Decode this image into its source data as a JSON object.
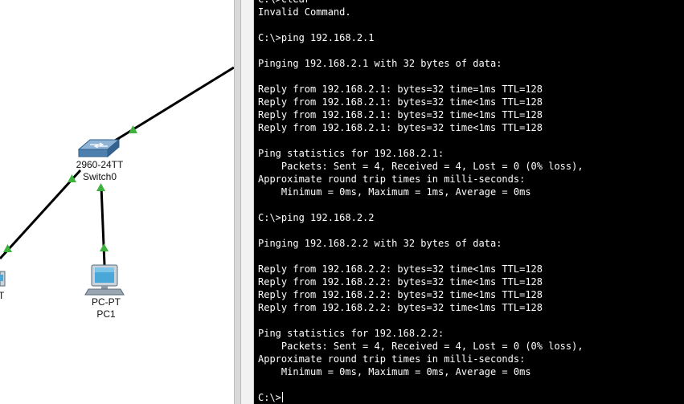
{
  "topology": {
    "devices": [
      {
        "id": "switch0",
        "model": "2960-24TT",
        "name": "Switch0"
      },
      {
        "id": "pc1",
        "model": "PC-PT",
        "name": "PC1"
      },
      {
        "id": "partial",
        "model_fragment": "T"
      }
    ],
    "link_color": "#000000",
    "link_light_color": "#3cb13c"
  },
  "terminal": {
    "lines": [
      "C:\\>clear",
      "Invalid Command.",
      "",
      "C:\\>ping 192.168.2.1",
      "",
      "Pinging 192.168.2.1 with 32 bytes of data:",
      "",
      "Reply from 192.168.2.1: bytes=32 time=1ms TTL=128",
      "Reply from 192.168.2.1: bytes=32 time<1ms TTL=128",
      "Reply from 192.168.2.1: bytes=32 time<1ms TTL=128",
      "Reply from 192.168.2.1: bytes=32 time<1ms TTL=128",
      "",
      "Ping statistics for 192.168.2.1:",
      "    Packets: Sent = 4, Received = 4, Lost = 0 (0% loss),",
      "Approximate round trip times in milli-seconds:",
      "    Minimum = 0ms, Maximum = 1ms, Average = 0ms",
      "",
      "C:\\>ping 192.168.2.2",
      "",
      "Pinging 192.168.2.2 with 32 bytes of data:",
      "",
      "Reply from 192.168.2.2: bytes=32 time<1ms TTL=128",
      "Reply from 192.168.2.2: bytes=32 time<1ms TTL=128",
      "Reply from 192.168.2.2: bytes=32 time<1ms TTL=128",
      "Reply from 192.168.2.2: bytes=32 time<1ms TTL=128",
      "",
      "Ping statistics for 192.168.2.2:",
      "    Packets: Sent = 4, Received = 4, Lost = 0 (0% loss),",
      "Approximate round trip times in milli-seconds:",
      "    Minimum = 0ms, Maximum = 0ms, Average = 0ms",
      ""
    ],
    "prompt": "C:\\>",
    "background": "#000000",
    "foreground": "#ffffff"
  }
}
